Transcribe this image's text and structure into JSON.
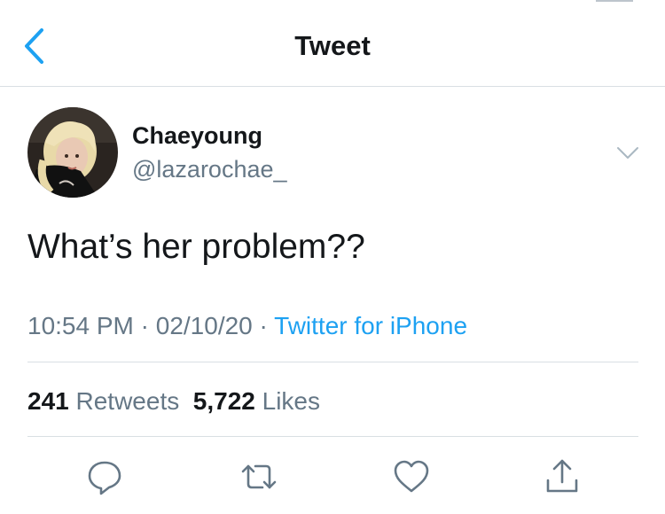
{
  "header": {
    "title": "Tweet",
    "back_icon": "chevron-left-icon"
  },
  "colors": {
    "accent": "#1da1f2",
    "secondary_text": "#657786",
    "primary_text": "#14171a",
    "divider": "#d9dfe3"
  },
  "tweet": {
    "display_name": "Chaeyoung",
    "handle": "@lazarochae_",
    "text": "What’s her problem??",
    "time": "10:54 PM",
    "date": "02/10/20",
    "separator": "·",
    "source": "Twitter for iPhone"
  },
  "stats": {
    "retweets_count": "241",
    "retweets_label": "Retweets",
    "likes_count": "5,722",
    "likes_label": "Likes"
  },
  "actions": {
    "reply_icon": "reply-icon",
    "retweet_icon": "retweet-icon",
    "like_icon": "heart-icon",
    "share_icon": "share-icon"
  }
}
